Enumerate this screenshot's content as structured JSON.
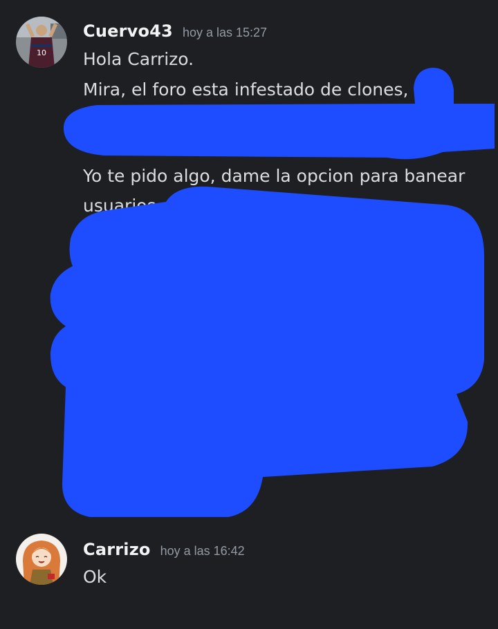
{
  "messages": [
    {
      "author": "Cuervo43",
      "timestamp": "hoy a las 15:27",
      "lines": [
        "Hola Carrizo.",
        "Mira, el foro esta infestado de clones,",
        "Yo te pido algo, dame la opcion para banear",
        "usuarios"
      ]
    },
    {
      "author": "Carrizo",
      "timestamp": "hoy a las 16:42",
      "lines": [
        "Ok"
      ]
    }
  ],
  "colors": {
    "background": "#1e1f22",
    "username": "#f2f3f5",
    "timestamp": "#949ba4",
    "text": "#dbdee1",
    "redaction": "#1e4cff"
  }
}
